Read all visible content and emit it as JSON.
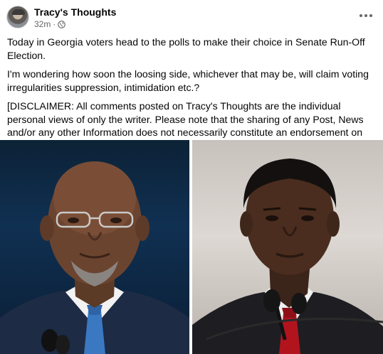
{
  "post": {
    "page_name": "Tracy's Thoughts",
    "timestamp": "32m",
    "separator": "·",
    "privacy_icon": "globe-icon",
    "more_icon": "more-horizontal-icon",
    "paragraphs": [
      "Today in Georgia voters head to the polls to make their choice in Senate Run-Off Election.",
      "I'm wondering how soon the loosing side, whichever that may be, will claim voting irregularities suppression, intimidation etc.?",
      "[DISCLAIMER: All comments posted on Tracy's Thoughts are the individual personal views of only the writer. Please note that the sharing of any Post, News and/or any other Information does not necessarily constitute an endorsement on behalf of Tracy's Thoughts and DOES NOT include any representation of the place of employment, agencies or organizations that the writer may be affiliated with.]"
    ]
  },
  "colors": {
    "text_primary": "#050505",
    "text_secondary": "#65676b",
    "background": "#ffffff"
  }
}
